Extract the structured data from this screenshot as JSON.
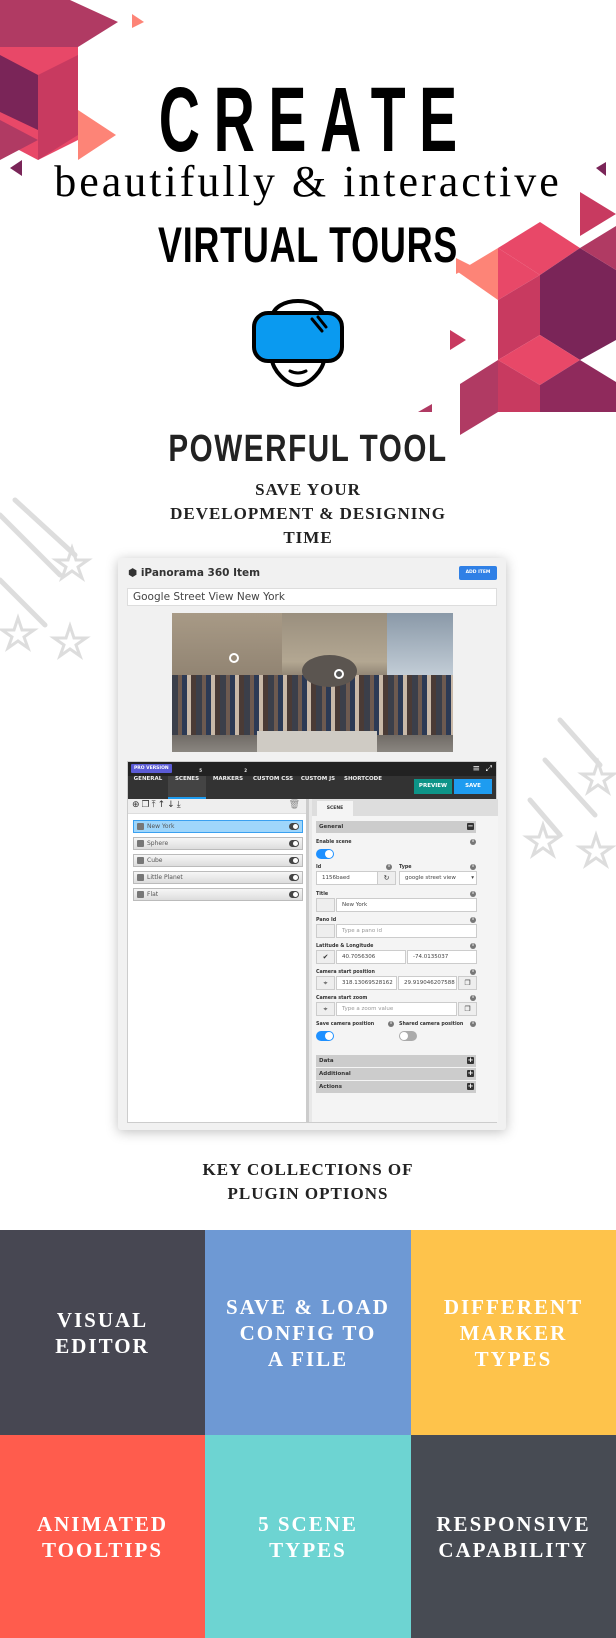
{
  "hero": {
    "title": "CREATE",
    "subtitle": "beautifully & interactive",
    "tagline": "VIRTUAL TOURS",
    "icon": "vr-headset-icon"
  },
  "section1": {
    "title": "POWERFUL TOOL",
    "line1": "SAVE YOUR",
    "line2": "DEVELOPMENT & DESIGNING",
    "line3": "TIME"
  },
  "app": {
    "title": "iPanorama 360 Item",
    "title_icon": "cubes-icon",
    "add_item": "ADD ITEM",
    "item_title": "Google Street View New York",
    "pro_badge": "PRO VERSION",
    "tabs": [
      {
        "label": "GENERAL",
        "badge": ""
      },
      {
        "label": "SCENES",
        "badge": "5"
      },
      {
        "label": "MARKERS",
        "badge": "2"
      },
      {
        "label": "CUSTOM CSS",
        "badge": ""
      },
      {
        "label": "CUSTOM JS",
        "badge": ""
      },
      {
        "label": "SHORTCODE",
        "badge": ""
      }
    ],
    "active_tab": "SCENES",
    "preview": "PREVIEW",
    "save": "SAVE",
    "toolbar_icons": [
      "plus-icon",
      "copy-icon",
      "move-top-icon",
      "move-up-icon",
      "move-down-icon",
      "move-bottom-icon",
      "trash-icon"
    ],
    "scenes": [
      {
        "name": "New York",
        "selected": true
      },
      {
        "name": "Sphere"
      },
      {
        "name": "Cube"
      },
      {
        "name": "Little Planet"
      },
      {
        "name": "Flat"
      }
    ],
    "scene_tab": "SCENE",
    "form": {
      "general": "General",
      "enable_scene": "Enable scene",
      "enable_scene_on": true,
      "id_label": "Id",
      "id_value": "1156baed",
      "type_label": "Type",
      "type_value": "google street view",
      "title_label": "Title",
      "title_value": "New York",
      "pano_label": "Pano Id",
      "pano_placeholder": "Type a pano id",
      "latlng_label": "Latitude & Longitude",
      "lat": "40.7056306",
      "lng": "-74.0135037",
      "cam_pos_label": "Camera start position",
      "cam_x": "318.13069528162",
      "cam_y": "29.919046207588",
      "cam_zoom_label": "Camera start zoom",
      "cam_zoom_placeholder": "Type a zoom value",
      "save_cam_label": "Save camera position",
      "save_cam_on": true,
      "shared_cam_label": "Shared camera position",
      "shared_cam_on": false,
      "sections": [
        "Data",
        "Additional",
        "Actions"
      ]
    }
  },
  "section2": {
    "line1": "KEY COLLECTIONS OF",
    "line2": "PLUGIN OPTIONS"
  },
  "tiles": [
    {
      "label": "VISUAL\nEDITOR",
      "color": "#474752"
    },
    {
      "label": "SAVE & LOAD\nCONFIG TO\nA FILE",
      "color": "#6e99d4"
    },
    {
      "label": "DIFFERENT\nMARKER\nTYPES",
      "color": "#fec34b"
    },
    {
      "label": "ANIMATED\nTOOLTIPS",
      "color": "#ff5c4d"
    },
    {
      "label": "5 SCENE\nTYPES",
      "color": "#6dd4d2"
    },
    {
      "label": "RESPONSIVE\nCAPABILITY",
      "color": "#474b53"
    }
  ]
}
